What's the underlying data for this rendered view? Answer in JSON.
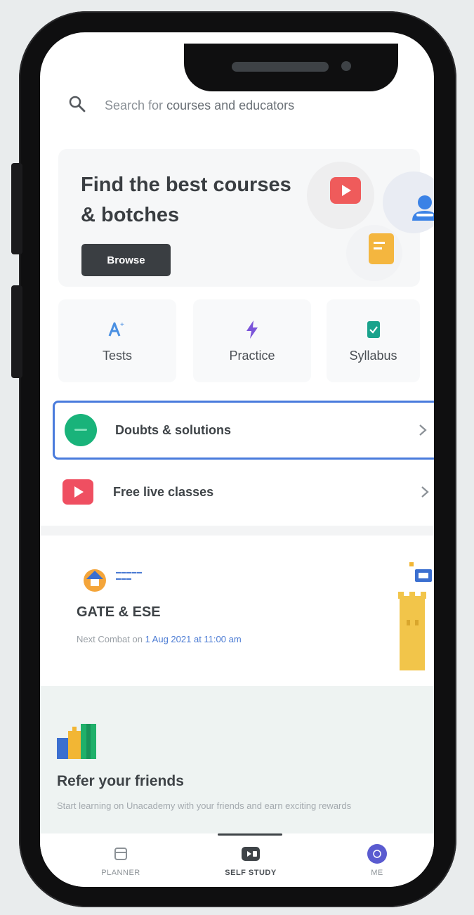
{
  "search": {
    "placeholder_prefix": "Search for",
    "placeholder_rest": "courses and educators",
    "icon": "search-icon"
  },
  "hero": {
    "title": "Find the best courses & botches",
    "browse_label": "Browse",
    "icons": [
      "video-icon",
      "user-icon",
      "document-icon"
    ],
    "colors": {
      "video": "#ef5b5b",
      "user": "#3b82e6",
      "doc": "#f4b63f"
    }
  },
  "quick_actions": [
    {
      "label": "Tests",
      "icon": "tests-icon",
      "color": "#4a90e2"
    },
    {
      "label": "Practice",
      "icon": "practice-icon",
      "color": "#7b55d9"
    },
    {
      "label": "Syllabus",
      "icon": "syllabus-icon",
      "color": "#1aa38c"
    }
  ],
  "list": [
    {
      "label": "Doubts & solutions",
      "icon": "doubts-icon",
      "color": "#19b37a",
      "selected": true
    },
    {
      "label": "Free live classes",
      "icon": "live-class-icon",
      "color": "#ef4f61",
      "selected": false
    }
  ],
  "combat": {
    "title": "GATE & ESE",
    "sub_prefix": "Next Combat on",
    "sub_date": "1 Aug 2021 at 11:00 am"
  },
  "refer": {
    "title": "Refer your friends",
    "subtitle": "Start learning on Unacademy with your friends and earn exciting rewards"
  },
  "bottom_nav": [
    {
      "label": "PLANNER",
      "icon": "planner-icon",
      "active": false
    },
    {
      "label": "SELF STUDY",
      "icon": "self-study-icon",
      "active": true
    },
    {
      "label": "ME",
      "icon": "profile-icon",
      "active": false
    }
  ],
  "colors": {
    "accent": "#4a7bdc",
    "dark_button": "#3a3e42",
    "link_blue": "#4b7bd3"
  }
}
